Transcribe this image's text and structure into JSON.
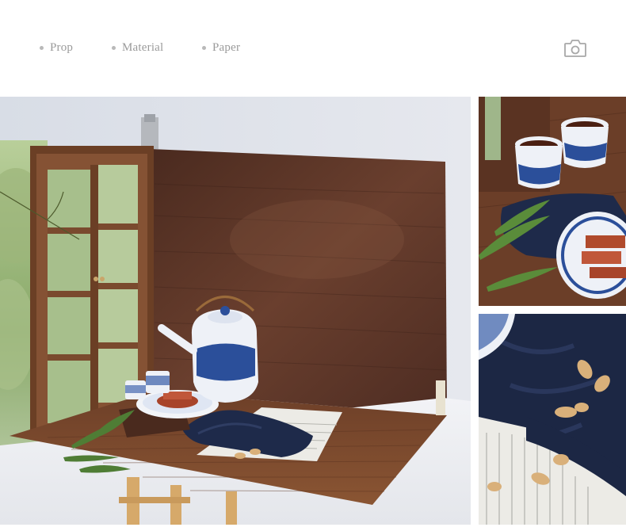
{
  "tags": [
    {
      "label": "Prop"
    },
    {
      "label": "Material"
    },
    {
      "label": "Paper"
    }
  ],
  "icons": {
    "camera": "camera-icon"
  },
  "colors": {
    "tag_text": "#9a9a9a",
    "wood_dark": "#5a3426",
    "wood_table": "#7a4a2c",
    "cloth_navy": "#1e2a4a",
    "porcelain_blue": "#2b4f9a"
  }
}
